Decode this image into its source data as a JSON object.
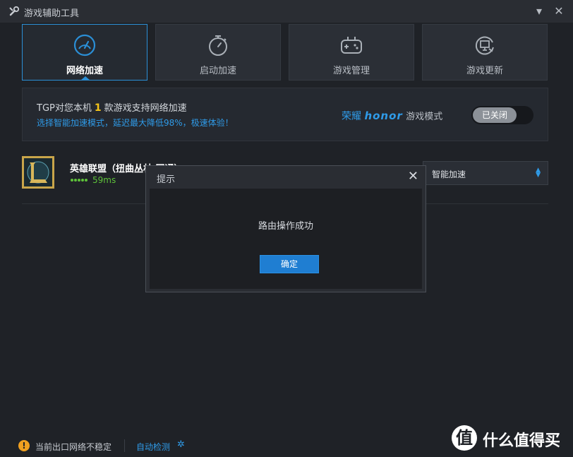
{
  "window": {
    "title": "游戏辅助工具",
    "minimize_glyph": "▾",
    "close_glyph": "✕"
  },
  "tabs": [
    {
      "label": "网络加速",
      "icon": "speedometer-icon",
      "active": true
    },
    {
      "label": "启动加速",
      "icon": "stopwatch-icon",
      "active": false
    },
    {
      "label": "游戏管理",
      "icon": "gamepad-icon",
      "active": false
    },
    {
      "label": "游戏更新",
      "icon": "monitor-refresh-icon",
      "active": false
    }
  ],
  "info": {
    "line1_prefix": "TGP对您本机",
    "count": "1",
    "line1_suffix": "款游戏支持网络加速",
    "line2": "选择智能加速模式，延迟最大降低98%，极速体验！",
    "honor_cn": "荣耀",
    "honor_brand": "honor",
    "honor_mode": "游戏模式",
    "toggle_label": "已关闭"
  },
  "game": {
    "name": "英雄联盟（扭曲丛林 网通）",
    "ping": "59ms",
    "mode": "智能加速",
    "signal_bars": 5
  },
  "dialog": {
    "title": "提示",
    "close_glyph": "✕",
    "message": "路由操作成功",
    "ok_label": "确定"
  },
  "footer": {
    "warn_glyph": "!",
    "status": "当前出口网络不稳定",
    "link": "自动检测",
    "gear_glyph": "✲"
  },
  "watermark": {
    "logo_glyph": "值",
    "text": "什么值得买"
  },
  "colors": {
    "accent": "#2b8fd6",
    "warning": "#f0a020",
    "ping": "#5ec23a",
    "highlight": "#f5c518"
  }
}
